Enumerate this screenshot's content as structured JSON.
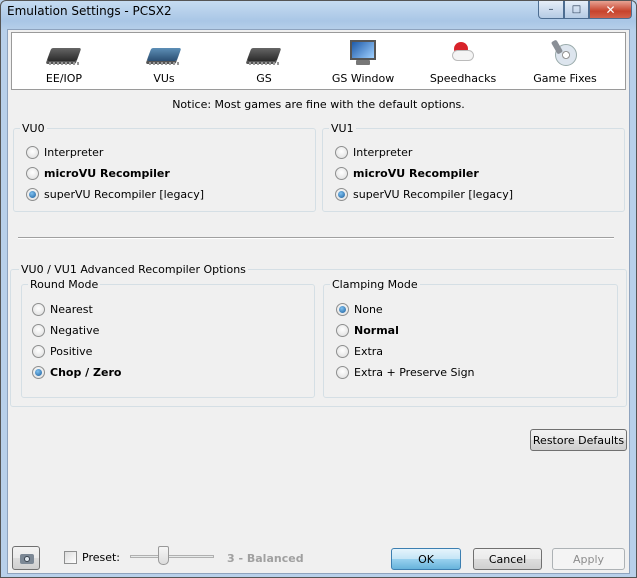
{
  "window": {
    "title": "Emulation Settings - PCSX2",
    "controls": {
      "minimize": "–",
      "maximize": "□",
      "close": "✕"
    }
  },
  "tabs": [
    {
      "label": "EE/IOP",
      "icon": "cpu-chip-icon"
    },
    {
      "label": "VUs",
      "icon": "vu-chip-icon",
      "selected": true
    },
    {
      "label": "GS",
      "icon": "gs-chip-icon"
    },
    {
      "label": "GS Window",
      "icon": "monitor-icon"
    },
    {
      "label": "Speedhacks",
      "icon": "pills-icon"
    },
    {
      "label": "Game Fixes",
      "icon": "disc-wrench-icon"
    }
  ],
  "notice": "Notice: Most games are fine with the default options.",
  "vu0": {
    "title": "VU0",
    "options": [
      "Interpreter",
      "microVU Recompiler",
      "superVU Recompiler [legacy]"
    ],
    "selected": 2
  },
  "vu1": {
    "title": "VU1",
    "options": [
      "Interpreter",
      "microVU Recompiler",
      "superVU Recompiler [legacy]"
    ],
    "selected": 2
  },
  "advanced": {
    "title": "VU0 / VU1 Advanced Recompiler Options",
    "round_mode": {
      "title": "Round Mode",
      "options": [
        "Nearest",
        "Negative",
        "Positive",
        "Chop / Zero"
      ],
      "selected": 3
    },
    "clamping_mode": {
      "title": "Clamping Mode",
      "options": [
        "None",
        "Normal",
        "Extra",
        "Extra + Preserve Sign"
      ],
      "selected": 0
    }
  },
  "buttons": {
    "restore_defaults": "Restore Defaults",
    "ok": "OK",
    "cancel": "Cancel",
    "apply": "Apply"
  },
  "preset": {
    "label": "Preset:",
    "value_text": "3 - Balanced",
    "checked": false
  },
  "colors": {
    "window_frame": "#b9d1ea",
    "dialog_bg": "#f0f0f0",
    "default_button": "#98d1ef",
    "disabled_text": "#8d8d8d"
  }
}
